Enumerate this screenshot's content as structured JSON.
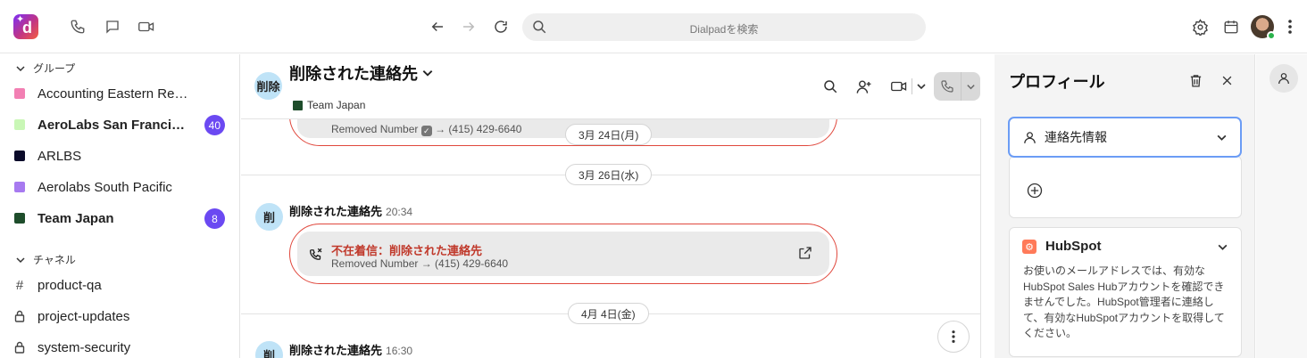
{
  "topbar": {
    "search_placeholder": "Dialpadを検索",
    "icons": [
      "phone-icon",
      "chat-icon",
      "video-icon",
      "back-icon",
      "forward-icon",
      "refresh-icon",
      "search-icon",
      "settings-icon",
      "calendar-icon",
      "more-icon"
    ]
  },
  "sidebar": {
    "groups_header": "グループ",
    "groups": [
      {
        "label": "Accounting Eastern Regions",
        "color": "#f27fb3",
        "bold": false,
        "badge": ""
      },
      {
        "label": "AeroLabs San Francisco",
        "color": "#c9f7b6",
        "bold": true,
        "badge": "40"
      },
      {
        "label": "ARLBS",
        "color": "#0b0b2a",
        "bold": false,
        "badge": ""
      },
      {
        "label": "Aerolabs South Pacific",
        "color": "#a77af0",
        "bold": false,
        "badge": ""
      },
      {
        "label": "Team Japan",
        "color": "#1e4d2b",
        "bold": true,
        "badge": "8"
      }
    ],
    "channels_header": "チャネル",
    "channels": [
      {
        "label": "product-qa",
        "prefix": "#"
      },
      {
        "label": "project-updates",
        "prefix": "lock"
      },
      {
        "label": "system-security",
        "prefix": "lock"
      }
    ]
  },
  "conversation": {
    "avatar_text": "削除",
    "title": "削除された連絡先",
    "subtitle": "Team Japan",
    "feed": {
      "top_card_number": "Removed Number",
      "top_card_phone": "→ (415) 429-6640",
      "dates": [
        "3月 24日(月)",
        "3月 26日(水)",
        "4月 4日(金)"
      ],
      "message1": {
        "avatar": "削",
        "name": "削除された連絡先",
        "time": "20:34",
        "call_title": "不在着信：削除された連絡先",
        "call_detail": "Removed Number → (415) 429-6640"
      },
      "message2": {
        "avatar": "削",
        "name": "削除された連絡先",
        "time": "16:30"
      }
    }
  },
  "profile": {
    "title": "プロフィール",
    "contact_info_label": "連絡先情報",
    "hubspot_title": "HubSpot",
    "hubspot_text": "お使いのメールアドレスでは、有効なHubSpot Sales Hubアカウントを確認できませんでした。HubSpot管理者に連絡して、有効なHubSpotアカウントを取得してください。"
  },
  "colors": {
    "accent": "#6b49f2",
    "missed_call": "#c0392b",
    "card_border": "#e0483d"
  }
}
